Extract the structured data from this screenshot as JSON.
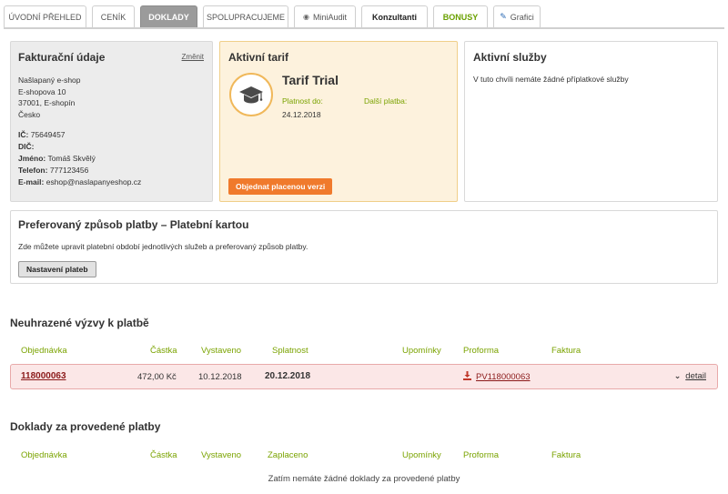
{
  "tabs": [
    {
      "label": "ÚVODNÍ PŘEHLED"
    },
    {
      "label": "CENÍK"
    },
    {
      "label": "DOKLADY"
    },
    {
      "label": "SPOLUPRACUJEME"
    },
    {
      "label": "MiniAudit",
      "icon": "eye-icon"
    },
    {
      "label": "Konzultanti"
    },
    {
      "label": "BONUSY"
    },
    {
      "label": "Grafici",
      "icon": "pen-icon"
    }
  ],
  "billing": {
    "title": "Fakturační údaje",
    "change_link": "Změnit",
    "address": [
      "Našlapaný e-shop",
      "E-shopova 10",
      "37001, E-shopín",
      "Česko"
    ],
    "ic_label": "IČ:",
    "ic_value": "75649457",
    "dic_label": "DIČ:",
    "dic_value": "",
    "name_label": "Jméno:",
    "name_value": "Tomáš Skvělý",
    "phone_label": "Telefon:",
    "phone_value": "777123456",
    "email_label": "E-mail:",
    "email_value": "eshop@naslapanyeshop.cz"
  },
  "tariff": {
    "title": "Aktivní tarif",
    "name": "Tarif Trial",
    "valid_label": "Platnost do:",
    "valid_value": "24.12.2018",
    "next_payment_label": "Další platba:",
    "next_payment_value": "",
    "order_button": "Objednat placenou verzi",
    "icon": "graduation-cap-icon"
  },
  "services": {
    "title": "Aktivní služby",
    "message": "V tuto chvíli nemáte žádné příplatkové služby"
  },
  "payment": {
    "title": "Preferovaný způsob platby – Platební kartou",
    "description": "Zde můžete upravit platební období jednotlivých služeb a preferovaný způsob platby.",
    "button": "Nastavení plateb"
  },
  "unpaid": {
    "title": "Neuhrazené výzvy k platbě",
    "columns": [
      "Objednávka",
      "Částka",
      "Vystaveno",
      "Splatnost",
      "Upomínky",
      "Proforma",
      "Faktura"
    ],
    "rows": [
      {
        "order": "118000063",
        "amount": "472,00 Kč",
        "issued": "10.12.2018",
        "due": "20.12.2018",
        "reminders": "",
        "proforma": "PV118000063",
        "invoice": "",
        "detail": "detail"
      }
    ]
  },
  "paid": {
    "title": "Doklady za provedené platby",
    "columns": [
      "Objednávka",
      "Částka",
      "Vystaveno",
      "Zaplaceno",
      "Upomínky",
      "Proforma",
      "Faktura"
    ],
    "empty_message": "Zatím nemáte žádné doklady za provedené platby"
  },
  "colors": {
    "accent_green": "#7aa300",
    "orange_button": "#f07a2c",
    "tariff_bg": "#fdf2dd",
    "unpaid_row_bg": "#fbe7e7",
    "active_tab": "#9b9b9b"
  }
}
